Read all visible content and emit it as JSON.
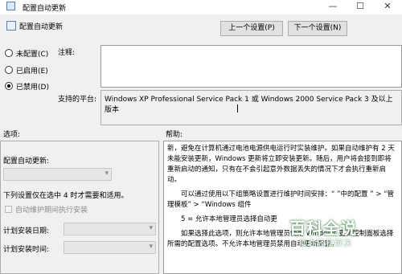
{
  "window": {
    "title": "配置自动更新",
    "minimize_glyph": "—",
    "maximize_glyph": "☐",
    "close_glyph": "✕"
  },
  "header": {
    "title": "配置自动更新",
    "prev_label": "上一个设置(P)",
    "next_label": "下一个设置(N)"
  },
  "state": {
    "not_configured": "未配置(C)",
    "enabled": "已启用(E)",
    "disabled": "已禁用(D)",
    "selected": "disabled"
  },
  "comment": {
    "label": "注释:",
    "value": ""
  },
  "platform": {
    "label": "支持的平台:",
    "value": "Windows XP Professional Service Pack 1 或 Windows 2000 Service Pack 3 及以上版本"
  },
  "sections": {
    "options_label": "选项:",
    "help_label": "帮助:"
  },
  "options": {
    "configure_label": "配置自动更新:",
    "configure_value": "",
    "note": "下列设置仅在选中 4 时才需要和适用。",
    "maintenance_checkbox": "自动维护期间执行安装",
    "schedule_day_label": "计划安装日期:",
    "schedule_day_value": "",
    "schedule_time_label": "计划安装时间:",
    "schedule_time_value": ""
  },
  "help": {
    "para1": "新，避免在计算机通过电池电源供电运行时实装维护。如果自动维护有 2 天未能安装更新，Windows 更新将立即安装更新。随后，用户将会接到即将重新启动的通知，只有在不会引起意外数据丢失的情况下才会执行重新启动。",
    "para2": "可以通过使用以下组策略设置进行维护时间安排：“ ”中的配置 ” > “管理模板” > “Windows 组件",
    "para3": "5 = 允许本地管理员选择自动更",
    "para4": "如果选择此选项，则允许本地管理员使用 Windows 更新控制面板选择所需的配置选项。不允许本地管理员禁用自动更新配置。"
  },
  "watermark": {
    "main": "百科全说",
    "sub": "助你轻松解决"
  }
}
